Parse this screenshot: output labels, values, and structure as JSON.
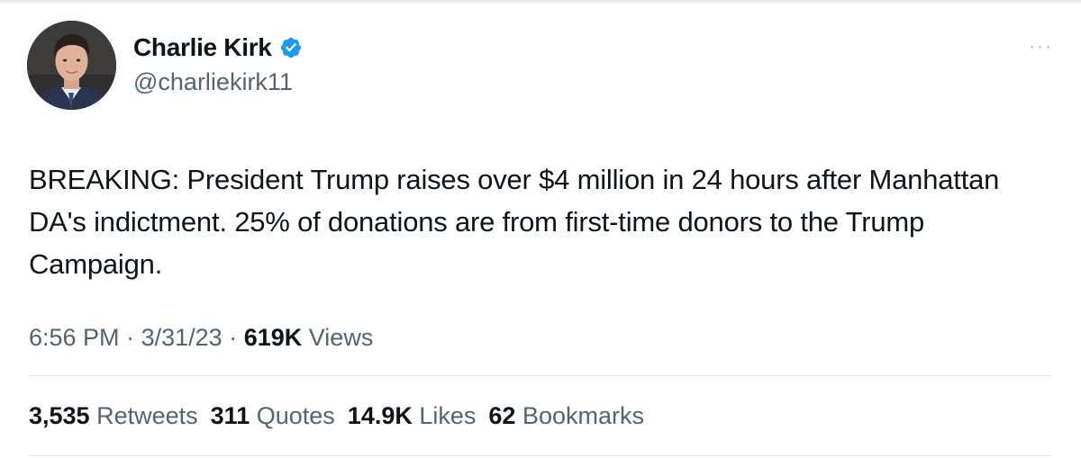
{
  "tweet": {
    "author": {
      "display_name": "Charlie Kirk",
      "handle": "@charliekirk11",
      "verified": true,
      "verified_color": "#1d9bf0"
    },
    "more_icon": "more-horizontal-icon",
    "text": "BREAKING: President Trump raises over $4 million in 24 hours after Manhattan DA's indictment. 25% of donations are from first-time donors to the Trump Campaign.",
    "time": "6:56 PM",
    "date": "3/31/23",
    "separator": "·",
    "views_count": "619K",
    "views_label": "Views",
    "stats": {
      "retweets": {
        "count": "3,535",
        "label": "Retweets"
      },
      "quotes": {
        "count": "311",
        "label": "Quotes"
      },
      "likes": {
        "count": "14.9K",
        "label": "Likes"
      },
      "bookmarks": {
        "count": "62",
        "label": "Bookmarks"
      }
    }
  },
  "colors": {
    "text_primary": "#0f1419",
    "text_secondary": "#536471",
    "divider": "#e3e6e8"
  }
}
